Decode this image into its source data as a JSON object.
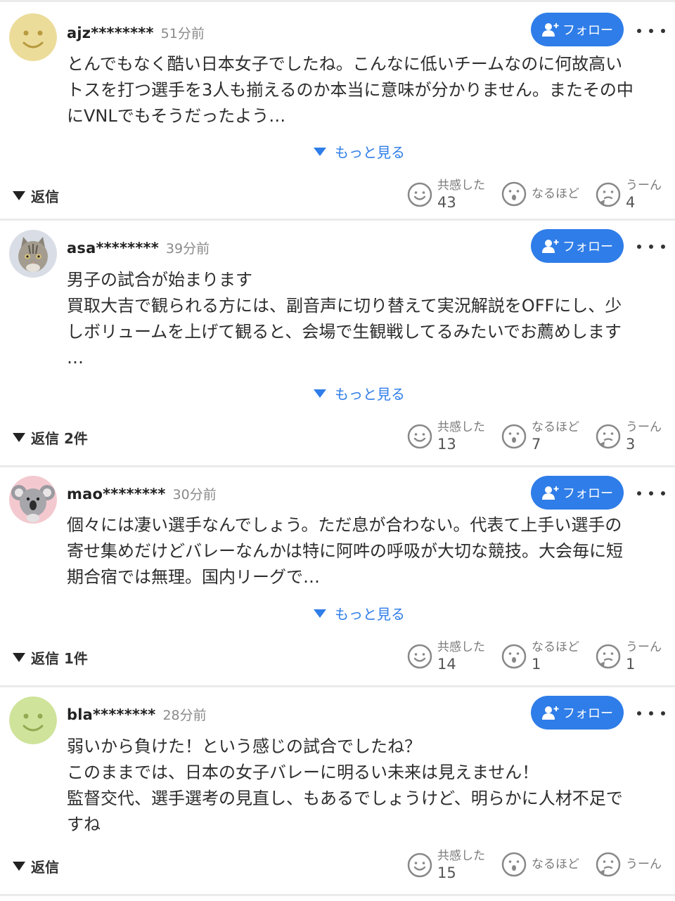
{
  "follow_label": "フォロー",
  "see_more_label": "もっと見る",
  "reaction_labels": {
    "empathy": "共感した",
    "naruhodo": "なるほど",
    "uun": "うーん"
  },
  "colors": {
    "accent": "#2f7de8",
    "divider": "#ebebeb"
  },
  "comments": [
    {
      "username": "ajz********",
      "time": "51分前",
      "avatar": "smiley-yellow-icon",
      "lines": [
        "とんでもなく酷い日本女子でしたね。こんなに低いチームなのに何故高い",
        "トスを打つ選手を3人も揃えるのか本当に意味が分かりません。またその中",
        "にVNLでもそうだったよう…"
      ],
      "reply_label": "返信",
      "reactions": {
        "empathy": "43",
        "naruhodo": "",
        "uun": "4"
      }
    },
    {
      "username": "asa********",
      "time": "39分前",
      "avatar": "cat-photo-icon",
      "lines": [
        "男子の試合が始まります",
        "買取大吉で観られる方には、副音声に切り替えて実況解説をOFFにし、少",
        "しボリュームを上げて観ると、会場で生観戦してるみたいでお薦めします",
        "…"
      ],
      "reply_label": "返信 2件",
      "reactions": {
        "empathy": "13",
        "naruhodo": "7",
        "uun": "3"
      }
    },
    {
      "username": "mao********",
      "time": "30分前",
      "avatar": "koala-photo-icon",
      "lines": [
        "個々には凄い選手なんでしょう。ただ息が合わない。代表て上手い選手の",
        "寄せ集めだけどバレーなんかは特に阿吽の呼吸が大切な競技。大会毎に短",
        "期合宿では無理。国内リーグで…"
      ],
      "reply_label": "返信 1件",
      "reactions": {
        "empathy": "14",
        "naruhodo": "1",
        "uun": "1"
      }
    },
    {
      "username": "bla********",
      "time": "28分前",
      "avatar": "smiley-green-icon",
      "lines": [
        "弱いから負けた！という感じの試合でしたね？",
        "このままでは、日本の女子バレーに明るい未来は見えません！",
        "監督交代、選手選考の見直し、もあるでしょうけど、明らかに人材不足で",
        "すね"
      ],
      "reply_label": "返信",
      "reactions": {
        "empathy": "15",
        "naruhodo": "",
        "uun": ""
      }
    }
  ]
}
